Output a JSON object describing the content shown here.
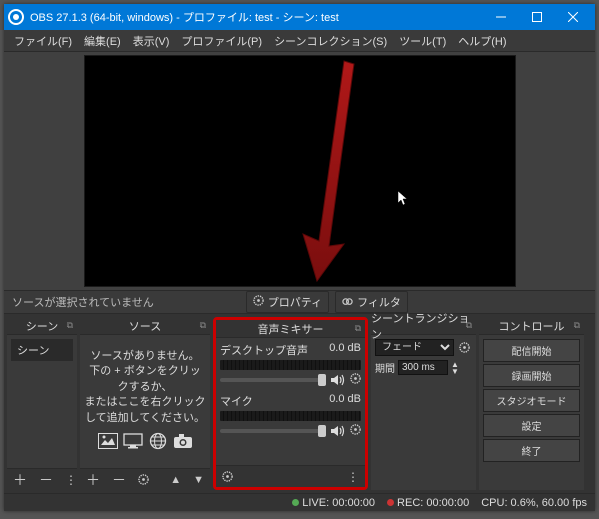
{
  "window": {
    "title": "OBS 27.1.3 (64-bit, windows) - プロファイル: test - シーン: test"
  },
  "menu": {
    "file": "ファイル(F)",
    "edit": "編集(E)",
    "view": "表示(V)",
    "profile": "プロファイル(P)",
    "scenecol": "シーンコレクション(S)",
    "tools": "ツール(T)",
    "help": "ヘルプ(H)"
  },
  "toolbar": {
    "no_selection": "ソースが選択されていません",
    "properties": "プロパティ",
    "filters": "フィルタ"
  },
  "panels": {
    "scenes": {
      "title": "シーン",
      "items": [
        "シーン"
      ]
    },
    "sources": {
      "title": "ソース",
      "empty1": "ソースがありません。",
      "empty2": "下の + ボタンをクリックするか、",
      "empty3": "またはここを右クリックして追加してください。"
    },
    "mixer": {
      "title": "音声ミキサー",
      "sources": [
        {
          "name": "デスクトップ音声",
          "db": "0.0 dB"
        },
        {
          "name": "マイク",
          "db": "0.0 dB"
        }
      ]
    },
    "transitions": {
      "title": "シーントランジション",
      "selected": "フェード",
      "duration_label": "期間",
      "duration_value": "300 ms"
    },
    "controls": {
      "title": "コントロール",
      "buttons": {
        "start_stream": "配信開始",
        "start_record": "録画開始",
        "studio": "スタジオモード",
        "settings": "設定",
        "exit": "終了"
      }
    }
  },
  "status": {
    "live_label": "LIVE:",
    "live_time": "00:00:00",
    "rec_label": "REC:",
    "rec_time": "00:00:00",
    "cpu": "CPU: 0.6%, 60.00 fps"
  }
}
